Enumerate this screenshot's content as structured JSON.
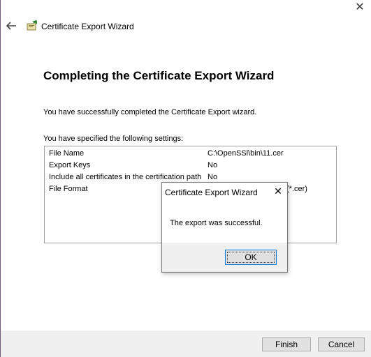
{
  "window": {
    "title": "Certificate Export Wizard",
    "close_glyph": "✕"
  },
  "page": {
    "heading": "Completing the Certificate Export Wizard",
    "intro": "You have successfully completed the Certificate Export wizard.",
    "settings_label": "You have specified the following settings:",
    "settings": [
      {
        "name": "File Name",
        "value": "C:\\OpenSSl\\bin\\11.cer"
      },
      {
        "name": "Export Keys",
        "value": "No"
      },
      {
        "name": "Include all certificates in the certification path",
        "value": "No"
      },
      {
        "name": "File Format",
        "value": "(*.cer)"
      }
    ]
  },
  "footer": {
    "finish_label": "Finish",
    "cancel_label": "Cancel"
  },
  "dialog": {
    "title": "Certificate Export Wizard",
    "close_glyph": "✕",
    "message": "The export was successful.",
    "ok_label": "OK"
  },
  "icons": {
    "back": "back-arrow-icon",
    "wizard": "certificate-wizard-icon",
    "close": "close-icon"
  },
  "colors": {
    "footer_bg": "#f0f0f0",
    "button_bg": "#e1e1e1",
    "focus_border": "#0078d7"
  }
}
